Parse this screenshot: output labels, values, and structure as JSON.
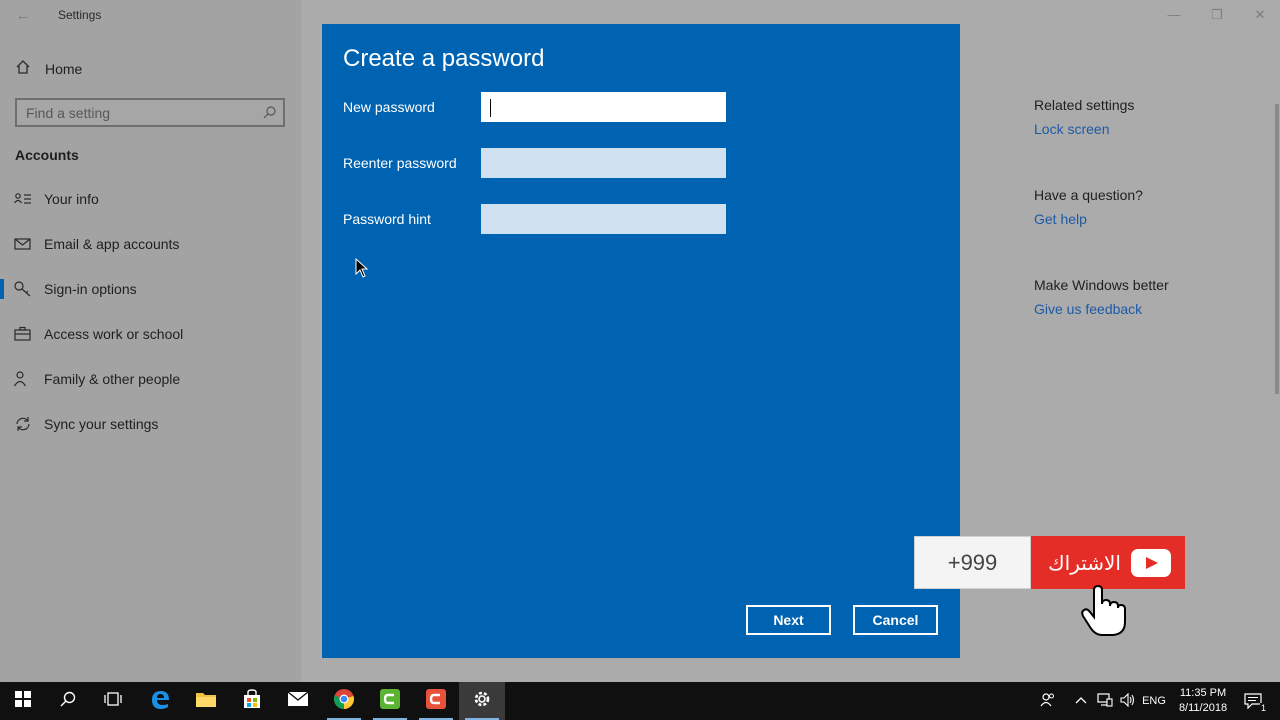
{
  "window": {
    "title": "Settings",
    "back_glyph": "←",
    "minimize_glyph": "—",
    "maximize_glyph": "❐",
    "close_glyph": "✕"
  },
  "sidebar": {
    "home_label": "Home",
    "search_placeholder": "Find a setting",
    "section_title": "Accounts",
    "items": [
      {
        "label": "Your info",
        "icon": "person-card-icon"
      },
      {
        "label": "Email & app accounts",
        "icon": "mail-icon"
      },
      {
        "label": "Sign-in options",
        "icon": "key-icon",
        "active": true
      },
      {
        "label": "Access work or school",
        "icon": "briefcase-icon"
      },
      {
        "label": "Family & other people",
        "icon": "people-icon"
      },
      {
        "label": "Sync your settings",
        "icon": "sync-icon"
      }
    ]
  },
  "related": {
    "sections": [
      {
        "heading": "Related settings",
        "link": "Lock screen"
      },
      {
        "heading": "Have a question?",
        "link": "Get help"
      },
      {
        "heading": "Make Windows better",
        "link": "Give us feedback"
      }
    ]
  },
  "dialog": {
    "title": "Create a password",
    "fields": [
      {
        "label": "New password",
        "value": ""
      },
      {
        "label": "Reenter password",
        "value": ""
      },
      {
        "label": "Password hint",
        "value": ""
      }
    ],
    "next_label": "Next",
    "cancel_label": "Cancel"
  },
  "subscribe": {
    "count": "+999",
    "label": "الاشتراك"
  },
  "taskbar": {
    "tray_lang": "ENG",
    "time": "11:35 PM",
    "date": "8/11/2018",
    "notification_count": "1"
  },
  "colors": {
    "accent": "#0063b1",
    "link": "#1d5aa6",
    "subscribe_red": "#e52d27"
  }
}
